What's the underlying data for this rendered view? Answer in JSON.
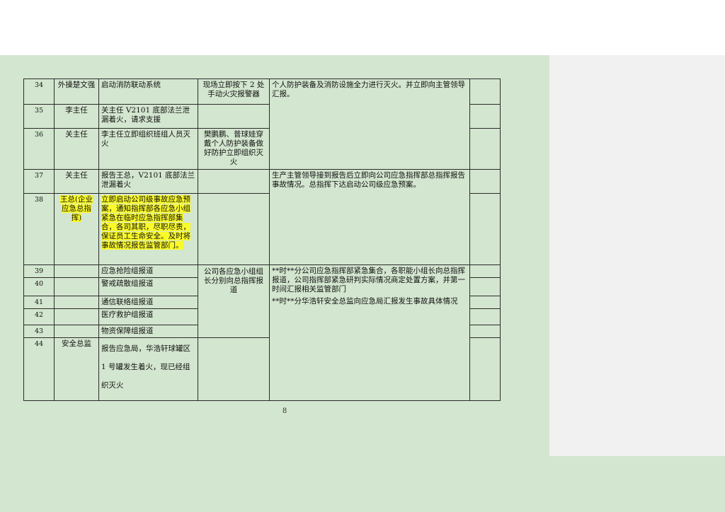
{
  "page": {
    "number": "8"
  },
  "rows": [
    {
      "num": "34",
      "role": "外操楚文强",
      "action": "启动消防联动系统",
      "onsite": "现场立即按下 2 处手动火灾报警器"
    },
    {
      "num": "35",
      "role": "李主任",
      "action": "关主任 V2101 底部法兰泄漏着火，请求支援"
    },
    {
      "num": "36",
      "role": "关主任",
      "action": "李主任立即组织班组人员灭火",
      "onsite": "樊鹏鹏、普球娃穿戴个人防护装备做好防护立即组织灭火"
    },
    {
      "num": "37",
      "role": "关主任",
      "action": "报告王总，V2101 底部法兰泄漏着火"
    },
    {
      "num": "38",
      "role": "王总(企业应急总指挥)",
      "action": "立即启动公司级事故应急预案，通知指挥部各应急小组紧急在临时应急指挥部集合，各司其职，尽职尽责，保证员工生命安全。及时将事故情况报告监管部门。"
    },
    {
      "num": "39",
      "role": "",
      "action": "应急抢险组报道"
    },
    {
      "num": "40",
      "role": "",
      "action": "警戒疏散组报道"
    },
    {
      "num": "41",
      "role": "",
      "action": "通信联络组报道"
    },
    {
      "num": "42",
      "role": "",
      "action": "医疗救护组报道"
    },
    {
      "num": "43",
      "role": "",
      "action": "物资保障组报道"
    },
    {
      "num": "44",
      "role": "安全总监",
      "action": "报告应急局，华浩轩球罐区 1 号罐发生着火，现已经组织灭火"
    }
  ],
  "merged": {
    "response_a": "个人防护装备及消防设施全力进行灭火。并立即向主管领导汇报。",
    "response_b": "生产主管领导接到报告后立即向公司应急指挥部总指挥报告事故情况。总指挥下达启动公司级应急预案。",
    "onsite_39_43": "公司各应急小组组长分别向总指挥报道",
    "response_c1": "**时**分公司应急指挥部紧急集合，各职能小组长向总指挥报道，公司指挥部紧急研判实际情况商定处置方案，并第一时间汇报相关监管部门",
    "response_c2": "**时**分华浩轩安全总监向应急局汇报发生事故具体情况"
  }
}
